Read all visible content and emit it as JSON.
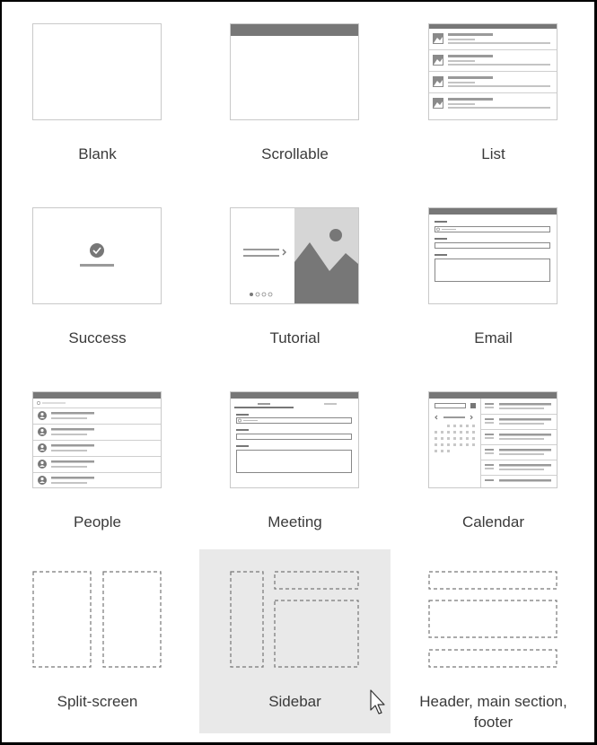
{
  "layouts": [
    {
      "name": "Blank"
    },
    {
      "name": "Scrollable"
    },
    {
      "name": "List"
    },
    {
      "name": "Success"
    },
    {
      "name": "Tutorial"
    },
    {
      "name": "Email"
    },
    {
      "name": "People"
    },
    {
      "name": "Meeting"
    },
    {
      "name": "Calendar"
    },
    {
      "name": "Split-screen"
    },
    {
      "name": "Sidebar"
    },
    {
      "name": "Header, main section, footer"
    }
  ],
  "selected_layout": "Sidebar",
  "colors": {
    "background": "#ffffff",
    "selected_tile": "#e9e9e9",
    "thumb_border": "#c9c9c9",
    "thumb_dark": "#777777",
    "label_text": "#3a3a3a"
  },
  "icons": {
    "pointer": "mouse-pointer-icon"
  }
}
